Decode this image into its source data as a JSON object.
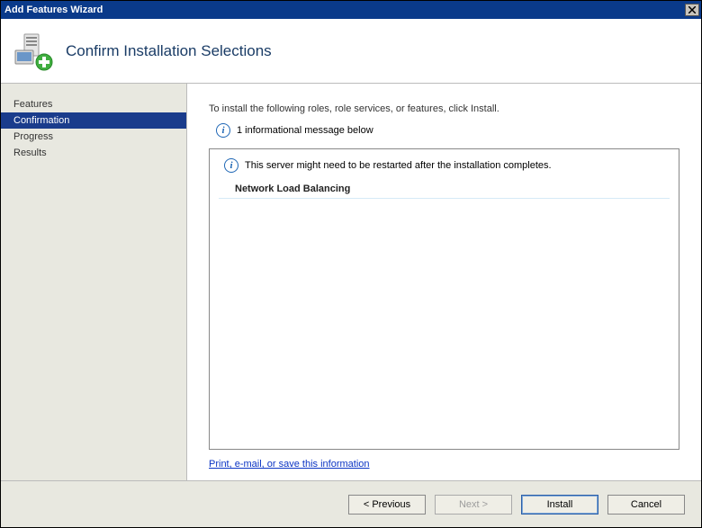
{
  "window": {
    "title": "Add Features Wizard"
  },
  "header": {
    "title": "Confirm Installation Selections"
  },
  "sidebar": {
    "items": [
      {
        "label": "Features"
      },
      {
        "label": "Confirmation"
      },
      {
        "label": "Progress"
      },
      {
        "label": "Results"
      }
    ]
  },
  "main": {
    "instruction": "To install the following roles, role services, or features, click Install.",
    "info_message": "1 informational message below",
    "restart_warning": "This server might need to be restarted after the installation completes.",
    "selected_feature": "Network Load Balancing",
    "link_text": "Print, e-mail, or save this information"
  },
  "footer": {
    "previous": "< Previous",
    "next": "Next >",
    "install": "Install",
    "cancel": "Cancel"
  }
}
